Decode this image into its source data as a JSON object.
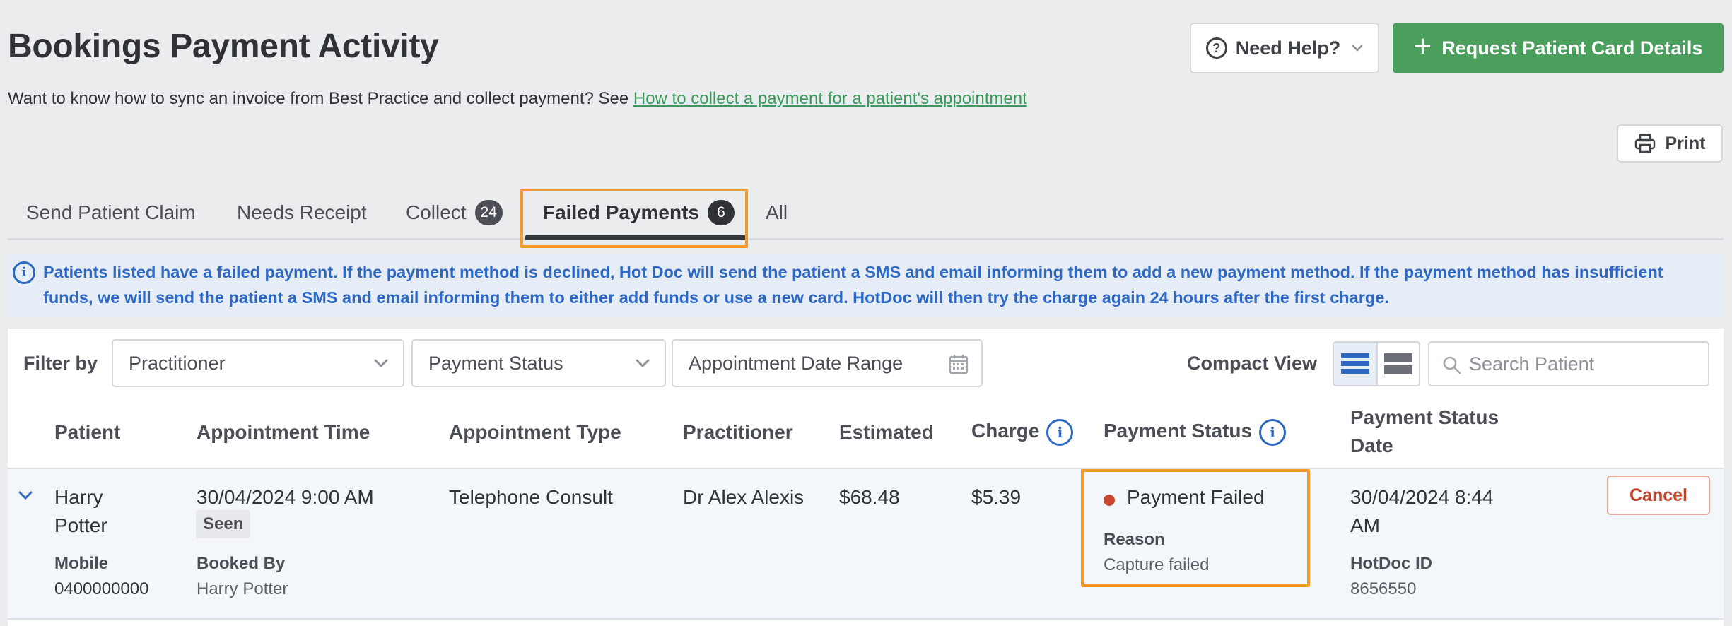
{
  "header": {
    "title": "Bookings Payment Activity",
    "intro_text": "Want to know how to sync an invoice from Best Practice and collect payment? See ",
    "intro_link": "How to collect a payment for a patient's appointment",
    "help_button": "Need Help?",
    "request_button": "Request Patient Card Details",
    "print_button": "Print"
  },
  "tabs": [
    {
      "label": "Send Patient Claim",
      "badge": null,
      "active": false
    },
    {
      "label": "Needs Receipt",
      "badge": null,
      "active": false
    },
    {
      "label": "Collect",
      "badge": "24",
      "active": false
    },
    {
      "label": "Failed Payments",
      "badge": "6",
      "active": true
    },
    {
      "label": "All",
      "badge": null,
      "active": false
    }
  ],
  "info_banner": "Patients listed have a failed payment. If the payment method is declined, Hot Doc will send the patient a SMS and email informing them to add a new payment method. If the payment method has insufficient funds, we will send the patient a SMS and email informing them to either add funds or use a new card. HotDoc will then try the charge again 24 hours after the first charge.",
  "filters": {
    "label": "Filter by",
    "practitioner": "Practitioner",
    "payment_status": "Payment Status",
    "date_range": "Appointment Date Range",
    "compact_view_label": "Compact View",
    "search_placeholder": "Search Patient"
  },
  "table": {
    "columns": {
      "patient": "Patient",
      "appointment_time": "Appointment Time",
      "appointment_type": "Appointment Type",
      "practitioner": "Practitioner",
      "estimated": "Estimated",
      "charge": "Charge",
      "payment_status": "Payment Status",
      "payment_status_date_1": "Payment Status",
      "payment_status_date_2": "Date"
    },
    "rows": [
      {
        "patient_first": "Harry",
        "patient_last": "Potter",
        "mobile_label": "Mobile",
        "mobile": "0400000000",
        "appointment_time": "30/04/2024 9:00 AM",
        "seen_badge": "Seen",
        "booked_by_label": "Booked By",
        "booked_by": "Harry Potter",
        "appointment_type": "Telephone Consult",
        "practitioner": "Dr Alex Alexis",
        "estimated": "$68.48",
        "charge": "$5.39",
        "payment_status": "Payment Failed",
        "reason_label": "Reason",
        "reason": "Capture failed",
        "status_date_1": "30/04/2024 8:44",
        "status_date_2": "AM",
        "hotdoc_id_label": "HotDoc ID",
        "hotdoc_id": "8656550",
        "action": "Cancel"
      }
    ]
  },
  "colors": {
    "accent_green": "#4a9f5c",
    "info_blue": "#2c68c4",
    "highlight_orange": "#f39a2c",
    "failed_red": "#c8472f"
  }
}
